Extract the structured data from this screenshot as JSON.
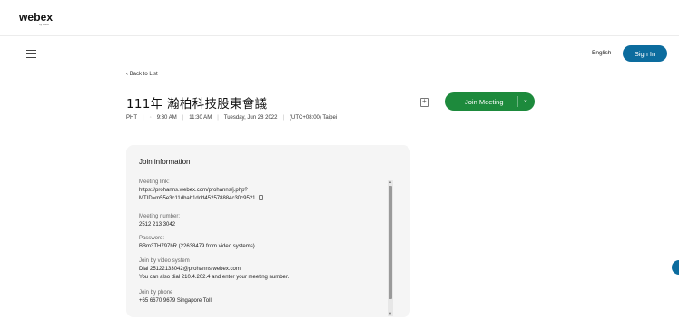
{
  "header": {
    "logo": "webex",
    "logo_sub": "by cisco",
    "language": "English",
    "sign_in": "Sign In"
  },
  "nav": {
    "back": "Back to List"
  },
  "meeting": {
    "title": "111年 瀚柏科技股東會議",
    "zone": "PHT",
    "start": "9:30 AM",
    "end": "11:30 AM",
    "date": "Tuesday, Jun 28 2022",
    "tz": "(UTC+08:00) Taipei",
    "join_label": "Join Meeting"
  },
  "join_info": {
    "title": "Join information",
    "meeting_link_label": "Meeting link:",
    "meeting_link_1": "https://prohanns.webex.com/prohanns/j.php?",
    "meeting_link_2": "MTID=m55e3c11dbab1ddd452578884c30c9521",
    "meeting_number_label": "Meeting number:",
    "meeting_number": "2512 213 3042",
    "password_label": "Password:",
    "password": "BBm3TH797hR (22638479 from video systems)",
    "video_label": "Join by video system",
    "video_dial": "Dial 25122133042@prohanns.webex.com",
    "video_alt": "You can also dial 210.4.202.4 and enter your meeting number.",
    "phone_label": "Join by phone",
    "phone_number": "+65 6670 9679 Singapore Toll"
  },
  "icons": {
    "copy": "copy-icon",
    "calendar": "add-to-calendar-icon",
    "chevron": "chevron-down-icon",
    "back": "chevron-left-icon",
    "menu": "hamburger-icon"
  },
  "colors": {
    "sign_in_bg": "#0c6c9e",
    "join_bg": "#1d8a3c"
  }
}
